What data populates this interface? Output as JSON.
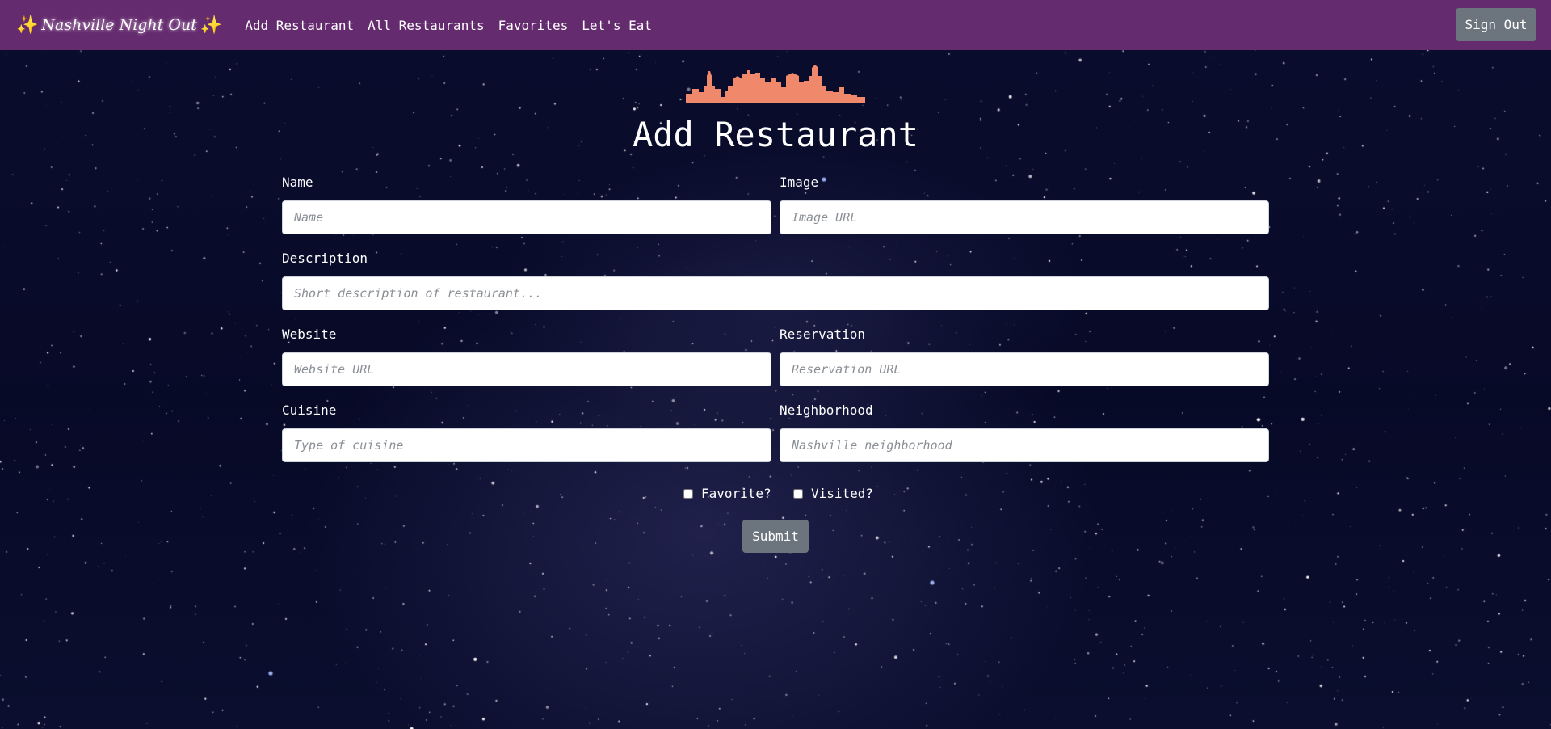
{
  "navbar": {
    "brand": "Nashville Night Out",
    "brand_spark": "✨",
    "links": [
      "Add Restaurant",
      "All Restaurants",
      "Favorites",
      "Let's Eat"
    ],
    "sign_out": "Sign Out"
  },
  "page": {
    "title": "Add Restaurant",
    "skyline_icon": "nashville-skyline"
  },
  "form": {
    "name": {
      "label": "Name",
      "placeholder": "Name",
      "value": ""
    },
    "image": {
      "label": "Image",
      "placeholder": "Image URL",
      "value": ""
    },
    "description": {
      "label": "Description",
      "placeholder": "Short description of restaurant...",
      "value": ""
    },
    "website": {
      "label": "Website",
      "placeholder": "Website URL",
      "value": ""
    },
    "reservation": {
      "label": "Reservation",
      "placeholder": "Reservation URL",
      "value": ""
    },
    "cuisine": {
      "label": "Cuisine",
      "placeholder": "Type of cuisine",
      "value": ""
    },
    "neighborhood": {
      "label": "Neighborhood",
      "placeholder": "Nashville neighborhood",
      "value": ""
    },
    "favorite": {
      "label": "Favorite?",
      "checked": false
    },
    "visited": {
      "label": "Visited?",
      "checked": false
    },
    "submit": "Submit"
  },
  "colors": {
    "navbar": "#652b6f",
    "background": "#070a27",
    "button": "#6c757d",
    "skyline": "#f0896b"
  }
}
